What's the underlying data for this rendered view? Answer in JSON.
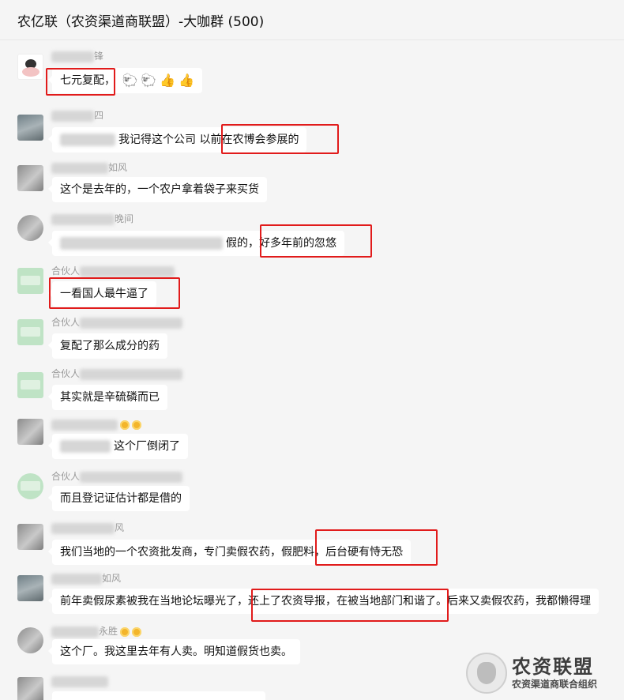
{
  "window": {
    "title": "农亿联（农资渠道商联盟）-大咖群 (500)"
  },
  "messages": [
    {
      "sender_suffix": "锋",
      "text": "七元复配，",
      "emojis": [
        "🐑",
        "🐑",
        "👍",
        "👍"
      ]
    },
    {
      "sender_suffix": "四",
      "text": "我记得这个公司 以前在农博会参展的"
    },
    {
      "sender_suffix": "如风",
      "text": "这个是去年的，一个农户拿着袋子来买货"
    },
    {
      "sender_suffix": "晚间",
      "text_a": "假的，",
      "text_b": "好多年前的忽悠"
    },
    {
      "sender_prefix": "合伙人",
      "text": "一看国人最牛逼了"
    },
    {
      "sender_prefix": "合伙人",
      "text": "复配了那么成分的药"
    },
    {
      "sender_prefix": "合伙人",
      "text": "其实就是辛硫磷而已"
    },
    {
      "sender_suffix": "",
      "text": "这个厂倒闭了"
    },
    {
      "sender_prefix": "合伙人",
      "text": "而且登记证估计都是借的"
    },
    {
      "sender_suffix": "风",
      "text_a": "我们当地的一个农资批发商，专门卖假农药，假肥料，",
      "text_b": "后台硬有恃无恐"
    },
    {
      "sender_suffix": "如风",
      "text": "前年卖假尿素被我在当地论坛曝光了，还上了农资导报，在被当地部门和谐了。后来又卖假农药，我都懒得理"
    },
    {
      "sender_suffix": "永胜",
      "text": "这个厂。我这里去年有人卖。明知道假货也卖。"
    }
  ],
  "watermark": {
    "title": "农资联盟",
    "subtitle": "农资渠道商联合组织"
  },
  "colors": {
    "highlight": "#e11b1b",
    "bubble": "#ffffff",
    "background": "#f5f5f5"
  }
}
